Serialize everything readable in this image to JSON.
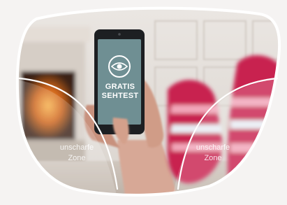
{
  "phone_screen": {
    "icon": "eye-icon",
    "line1": "GRATIS",
    "line2": "SEHTEST"
  },
  "zones": {
    "left": {
      "line1": "unscharfe",
      "line2": "Zone"
    },
    "right": {
      "line1": "unscharfe",
      "line2": "Zone"
    }
  },
  "colors": {
    "frame": "#f5f3f2",
    "screen": "#6f8f93",
    "socks": "#c8244f"
  }
}
